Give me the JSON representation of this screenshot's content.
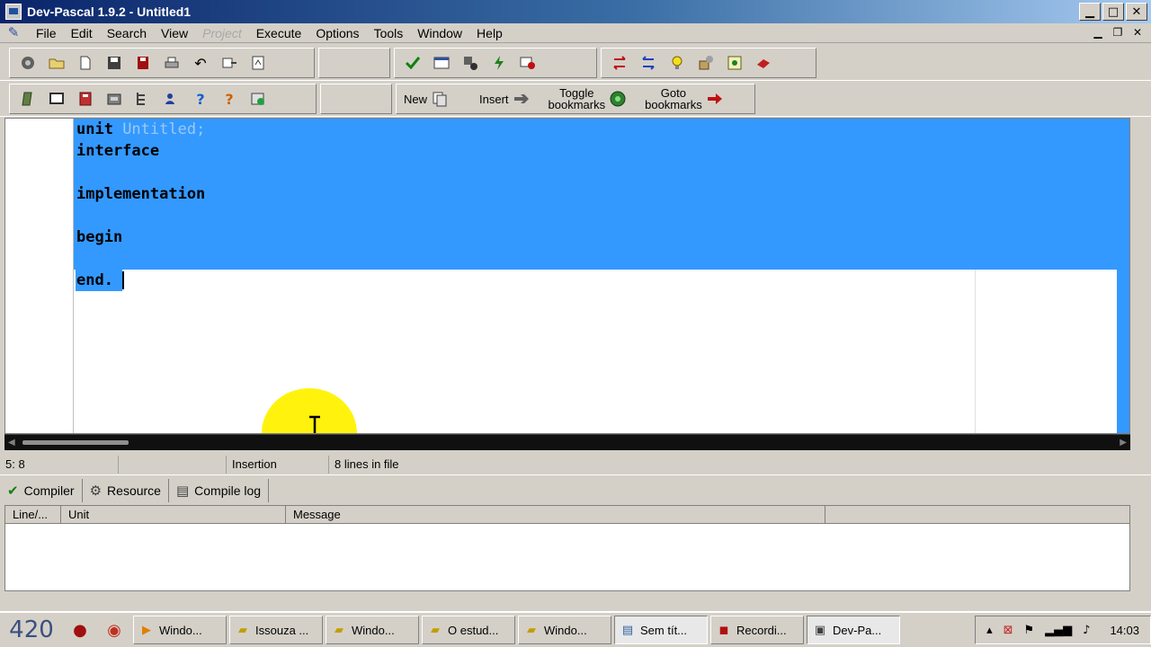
{
  "window": {
    "title": "Dev-Pascal 1.9.2 - Untitled1"
  },
  "menu": [
    {
      "label": "File",
      "disabled": false
    },
    {
      "label": "Edit",
      "disabled": false
    },
    {
      "label": "Search",
      "disabled": false
    },
    {
      "label": "View",
      "disabled": false
    },
    {
      "label": "Project",
      "disabled": true
    },
    {
      "label": "Execute",
      "disabled": false
    },
    {
      "label": "Options",
      "disabled": false
    },
    {
      "label": "Tools",
      "disabled": false
    },
    {
      "label": "Window",
      "disabled": false
    },
    {
      "label": "Help",
      "disabled": false
    }
  ],
  "toolbar2": {
    "new_label": "New",
    "insert_label": "Insert",
    "toggle_line1": "Toggle",
    "toggle_line2": "bookmarks",
    "goto_line1": "Goto",
    "goto_line2": "bookmarks"
  },
  "editor": {
    "lines": [
      {
        "kw": "unit ",
        "ident": "Untitled;"
      },
      {
        "kw": "interface",
        "ident": ""
      },
      {
        "kw": "",
        "ident": ""
      },
      {
        "kw": "implementation",
        "ident": ""
      },
      {
        "kw": "",
        "ident": ""
      },
      {
        "kw": "begin",
        "ident": ""
      },
      {
        "kw": "",
        "ident": ""
      },
      {
        "kw": "end.",
        "ident": ""
      }
    ],
    "selection_color": "#3399ff"
  },
  "status": {
    "position": "5: 8",
    "mode": "Insertion",
    "lines_info": "8 lines in file"
  },
  "bottom_tabs": [
    {
      "label": "Compiler",
      "icon": "check-icon"
    },
    {
      "label": "Resource",
      "icon": "resource-icon"
    },
    {
      "label": "Compile log",
      "icon": "log-icon"
    }
  ],
  "messages": {
    "columns": [
      "Line/...",
      "Unit",
      "Message"
    ]
  },
  "taskbar": {
    "start_label": "420",
    "tasks": [
      {
        "label": "Windo...",
        "icon": "windows-media-icon",
        "active": false
      },
      {
        "label": "Issouza ...",
        "icon": "folder-icon",
        "active": false
      },
      {
        "label": "Windo...",
        "icon": "folder-icon",
        "active": false
      },
      {
        "label": "O estud...",
        "icon": "folder-icon",
        "active": false
      },
      {
        "label": "Windo...",
        "icon": "folder-icon",
        "active": false
      },
      {
        "label": "Sem tít...",
        "icon": "notepad-icon",
        "active": true
      },
      {
        "label": "Recordi...",
        "icon": "recorder-icon",
        "active": false
      },
      {
        "label": "Dev-Pa...",
        "icon": "devpascal-icon",
        "active": true
      }
    ],
    "clock": "14:03"
  }
}
